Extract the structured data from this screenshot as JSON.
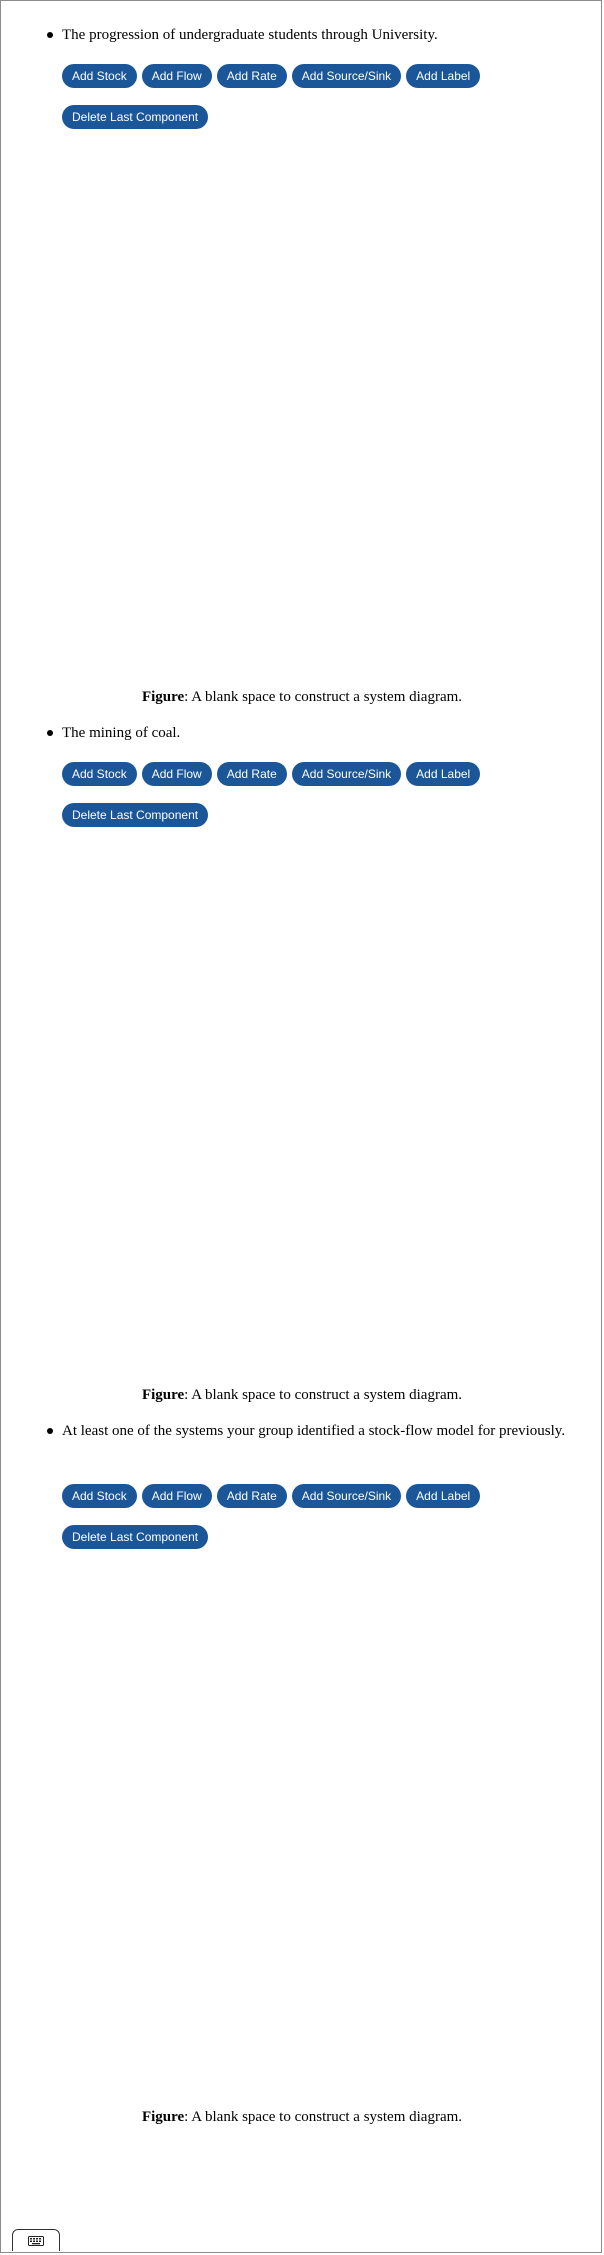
{
  "buttons": {
    "add_stock": "Add Stock",
    "add_flow": "Add Flow",
    "add_rate": "Add Rate",
    "add_source_sink": "Add Source/Sink",
    "add_label": "Add Label",
    "delete_last": "Delete Last Component"
  },
  "sections": [
    {
      "prompt": "The progression of undergraduate students through University.",
      "caption_bold": "Figure",
      "caption_text": ": A blank space to construct a system diagram."
    },
    {
      "prompt": "The mining of coal.",
      "caption_bold": "Figure",
      "caption_text": ": A blank space to construct a system diagram."
    },
    {
      "prompt": "At least one of the systems your group identified a stock-flow model for previously.",
      "caption_bold": "Figure",
      "caption_text": ": A blank space to construct a system diagram."
    }
  ],
  "keyboard_toggle": {
    "icon": "keyboard-icon"
  }
}
